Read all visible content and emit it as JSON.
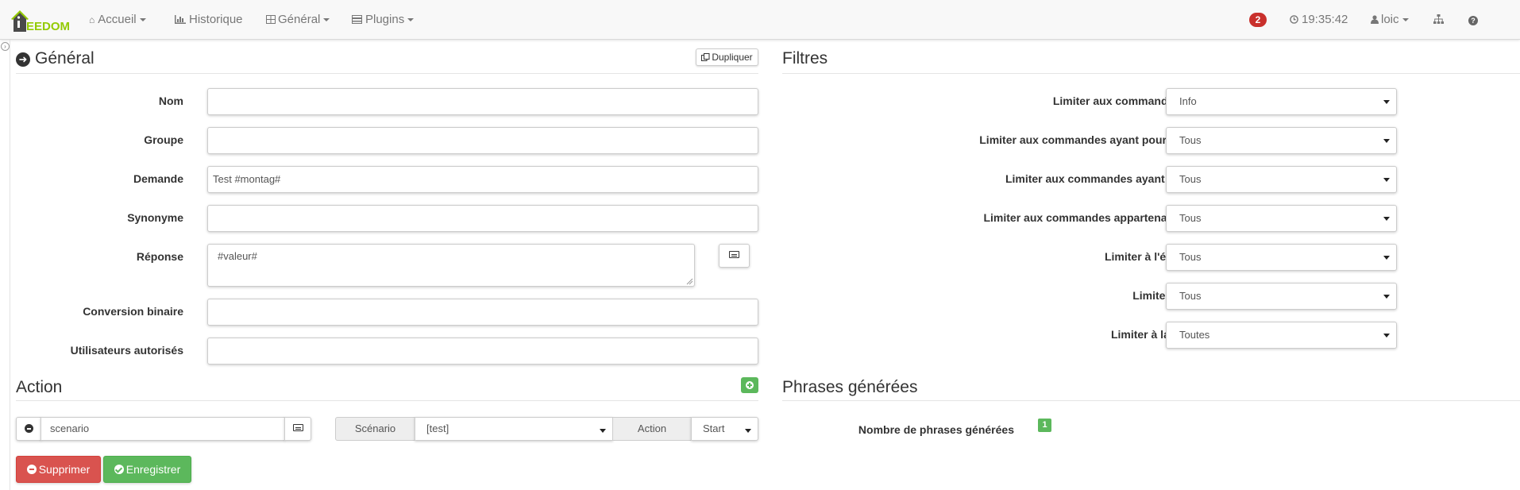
{
  "app": {
    "logo_text": "EEDOM"
  },
  "navbar": {
    "accueil": "Accueil",
    "historique": "Historique",
    "general": "Général",
    "plugins": "Plugins",
    "notifications_count": "2",
    "time": "19:35:42",
    "user": "loic"
  },
  "general": {
    "title": "Général",
    "duplicate_label": "Dupliquer",
    "fields": {
      "nom": {
        "label": "Nom",
        "value": ""
      },
      "groupe": {
        "label": "Groupe",
        "value": ""
      },
      "demande": {
        "label": "Demande",
        "value": "Test #montag#"
      },
      "synonyme": {
        "label": "Synonyme",
        "value": ""
      },
      "reponse": {
        "label": "Réponse",
        "value": "#valeur#"
      },
      "conversion": {
        "label": "Conversion binaire",
        "value": ""
      },
      "utilisateurs": {
        "label": "Utilisateurs autorisés",
        "value": ""
      }
    }
  },
  "filtres": {
    "title": "Filtres",
    "rows": [
      {
        "label": "Limiter aux commandes de type",
        "value": "Info"
      },
      {
        "label": "Limiter aux commandes ayant pour sous-type",
        "value": "Tous"
      },
      {
        "label": "Limiter aux commandes ayant pour unité",
        "value": "Tous"
      },
      {
        "label": "Limiter aux commandes appartenant à l'objet",
        "value": "Tous"
      },
      {
        "label": "Limiter à l'équipement",
        "value": "Tous"
      },
      {
        "label": "Limiter au plugin",
        "value": "Tous"
      },
      {
        "label": "Limiter à la catégorie",
        "value": "Toutes"
      }
    ]
  },
  "action": {
    "title": "Action",
    "command_value": "scenario",
    "scenario_label": "Scénario",
    "scenario_value": "[test]",
    "action_label": "Action",
    "action_value": "Start"
  },
  "phrases": {
    "title": "Phrases générées",
    "count_label": "Nombre de phrases générées",
    "count": "1"
  },
  "buttons": {
    "delete": "Supprimer",
    "save": "Enregistrer"
  },
  "colors": {
    "brand_green": "#93ca02",
    "success": "#5cb85c",
    "danger": "#d9534f",
    "badge": "#c9302c"
  }
}
